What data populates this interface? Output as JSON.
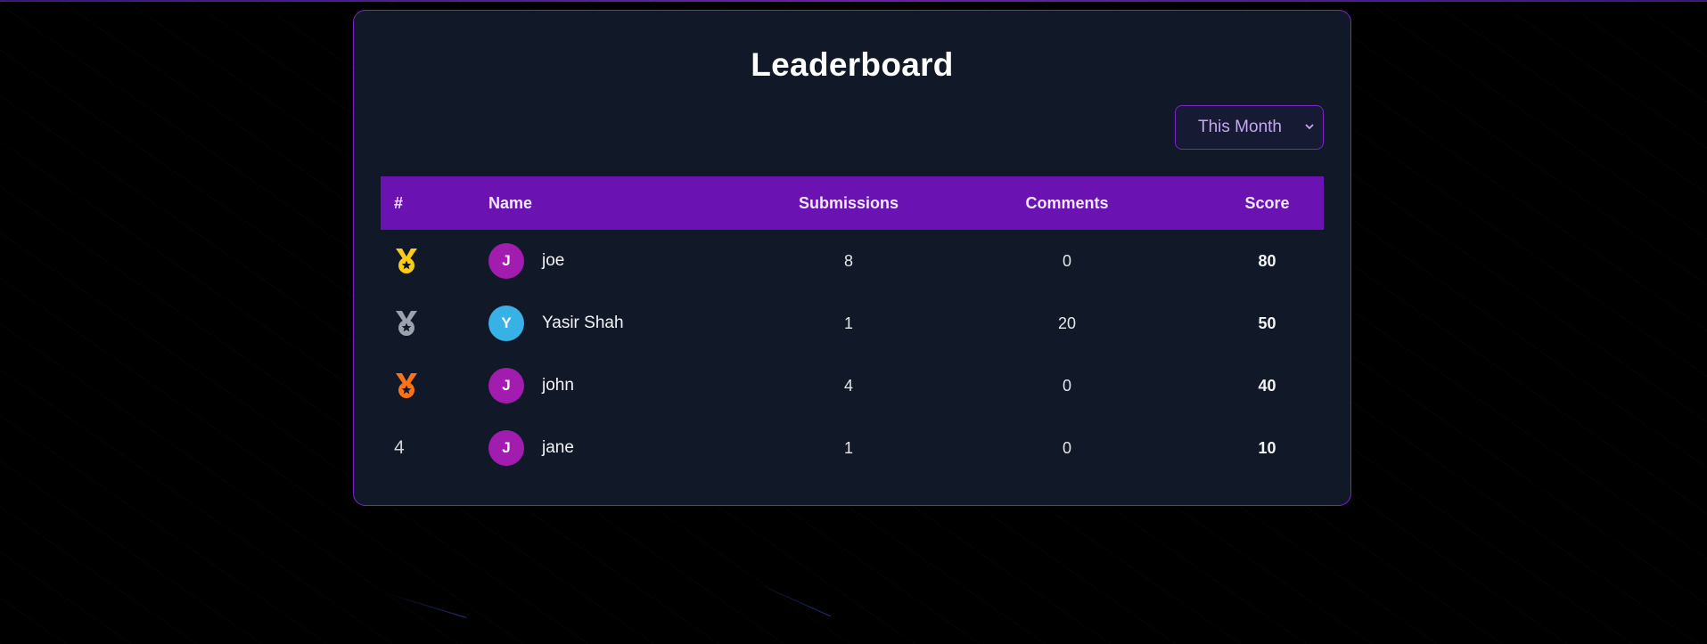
{
  "page": {
    "title": "Leaderboard"
  },
  "filter": {
    "selected": "This Month"
  },
  "table": {
    "headers": {
      "rank": "#",
      "name": "Name",
      "submissions": "Submissions",
      "comments": "Comments",
      "score": "Score"
    },
    "rows": [
      {
        "rank": "1",
        "medal": "gold-medal",
        "initial": "J",
        "avatar_color": "#a21caf",
        "name": "joe",
        "submissions": "8",
        "comments": "0",
        "score": "80"
      },
      {
        "rank": "2",
        "medal": "silver-medal",
        "initial": "Y",
        "avatar_color": "#38b2e6",
        "name": "Yasir Shah",
        "submissions": "1",
        "comments": "20",
        "score": "50"
      },
      {
        "rank": "3",
        "medal": "bronze-medal",
        "initial": "J",
        "avatar_color": "#a21caf",
        "name": "john",
        "submissions": "4",
        "comments": "0",
        "score": "40"
      },
      {
        "rank": "4",
        "medal": "",
        "initial": "J",
        "avatar_color": "#a21caf",
        "name": "jane",
        "submissions": "1",
        "comments": "0",
        "score": "10"
      }
    ]
  },
  "colors": {
    "accent": "#7e22ce",
    "header_bg": "#6b12b3",
    "card_bg": "#111827",
    "gold": "#facc15",
    "silver": "#9ca3af",
    "bronze": "#f97316"
  }
}
